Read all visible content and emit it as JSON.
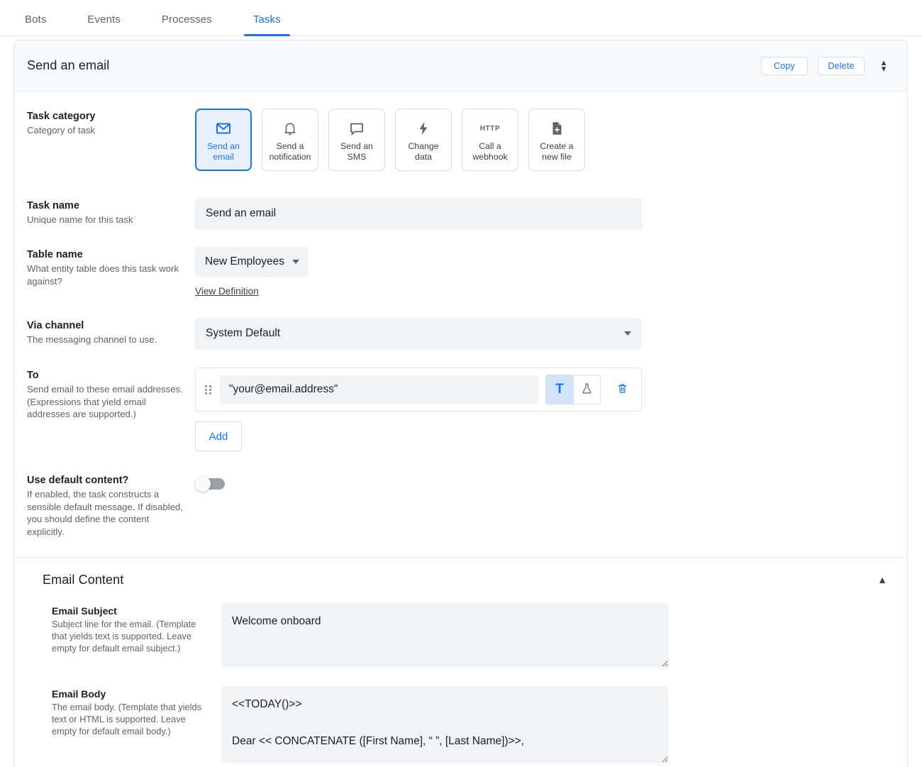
{
  "tabs": [
    {
      "label": "Bots",
      "active": false
    },
    {
      "label": "Events",
      "active": false
    },
    {
      "label": "Processes",
      "active": false
    },
    {
      "label": "Tasks",
      "active": true
    }
  ],
  "header": {
    "title": "Send an email",
    "copy_label": "Copy",
    "delete_label": "Delete"
  },
  "fields": {
    "task_category": {
      "title": "Task category",
      "desc": "Category of task",
      "options": [
        {
          "label": "Send an email",
          "icon": "envelope-icon",
          "selected": true
        },
        {
          "label": "Send a notification",
          "icon": "bell-icon",
          "selected": false
        },
        {
          "label": "Send an SMS",
          "icon": "chat-bubble-icon",
          "selected": false
        },
        {
          "label": "Change data",
          "icon": "lightning-bolt-icon",
          "selected": false
        },
        {
          "label": "Call a webhook",
          "icon": "http-icon",
          "icon_text": "HTTP",
          "selected": false
        },
        {
          "label": "Create a new file",
          "icon": "file-add-icon",
          "selected": false
        }
      ]
    },
    "task_name": {
      "title": "Task name",
      "desc": "Unique name for this task",
      "value": "Send an email"
    },
    "table_name": {
      "title": "Table name",
      "desc": "What entity table does this task work against?",
      "value": "New Employees",
      "link_label": "View Definition"
    },
    "via_channel": {
      "title": "Via channel",
      "desc": "The messaging channel to use.",
      "value": "System Default"
    },
    "to": {
      "title": "To",
      "desc": "Send email to these email addresses. (Expressions that yield email addresses are supported.)",
      "value": "\"your@email.address\"",
      "mode_text_label": "T",
      "mode_expression_label": "flask-icon",
      "add_label": "Add"
    },
    "use_default_content": {
      "title": "Use default content?",
      "desc": "If enabled, the task constructs a sensible default message. If disabled, you should define the content explicitly.",
      "enabled": false
    }
  },
  "email_content": {
    "section_title": "Email Content",
    "subject": {
      "title": "Email Subject",
      "desc": "Subject line for the email. (Template that yields text is supported. Leave empty for default email subject.)",
      "value": "Welcome onboard"
    },
    "body": {
      "title": "Email Body",
      "desc": "The email body. (Template that yields text or HTML is supported. Leave empty for default email body.)",
      "value": "<<TODAY()>>\n\nDear << CONCATENATE ([First Name], “ ”, [Last Name])>>,"
    }
  },
  "colors": {
    "accent": "#1a73e8",
    "selected_bg": "#e8f0fe",
    "field_bg": "#f1f3f4",
    "header_bg": "#f8f9fa",
    "text": "#202124",
    "muted": "#5f6368"
  }
}
